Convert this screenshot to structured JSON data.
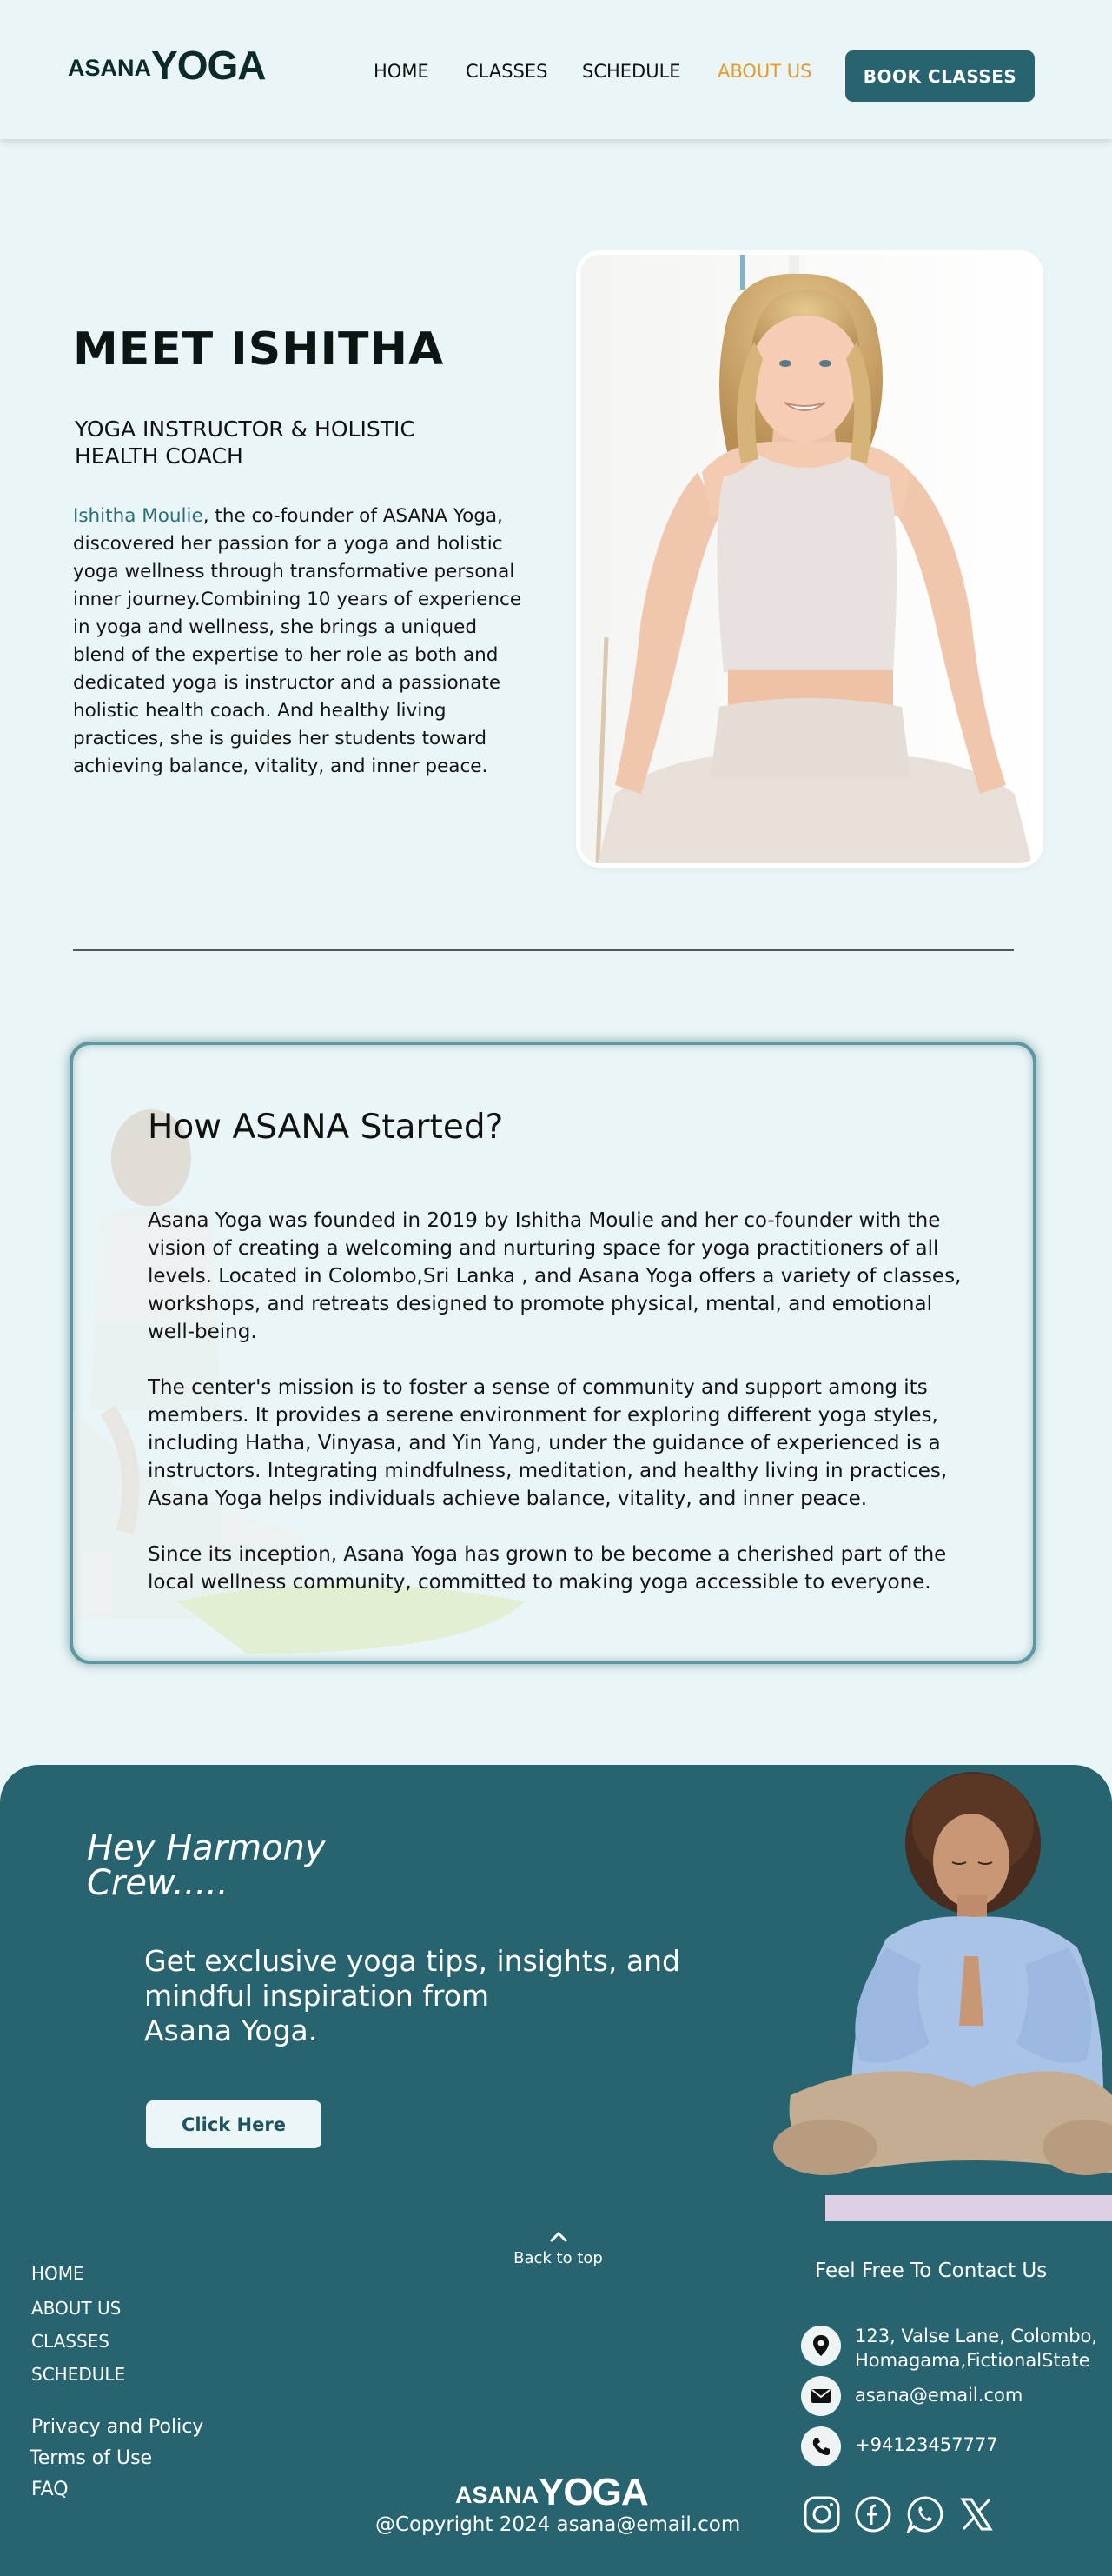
{
  "header": {
    "logo_small": "ASANA",
    "logo_big": "YOGA",
    "nav": [
      "HOME",
      "CLASSES",
      "SCHEDULE",
      "ABOUT US"
    ],
    "active_nav": "ABOUT US",
    "book_label": "BOOK  CLASSES"
  },
  "meet": {
    "title": "MEET  ISHITHA",
    "subtitle": "YOGA INSTRUCTOR & HOLISTIC HEALTH COACH",
    "bio_name": "Ishitha Moulie",
    "bio_text": ", the co-founder of ASANA Yoga, discovered her passion for a yoga and holistic yoga wellness through transformative personal  inner journey.Combining 10 years of experience in yoga and wellness, she brings a uniqued  blend of the expertise to her role as both and dedicated yoga is instructor and a passionate holistic health coach. And healthy living practices, she is guides her students toward achieving balance, vitality, and inner peace."
  },
  "story": {
    "title": "How ASANA Started?",
    "paragraphs": [
      "Asana Yoga was founded in 2019 by Ishitha Moulie and her co-founder with the vision of creating a welcoming and nurturing space for yoga practitioners of all levels. Located in Colombo,Sri Lanka ,  and Asana Yoga offers a variety of classes, workshops, and retreats designed to promote physical, mental, and emotional well-being.",
      "The center's mission is to foster a sense of community and support among its members. It provides a serene environment for exploring different yoga styles, including Hatha, Vinyasa, and Yin Yang, under the guidance of experienced  is a instructors. Integrating mindfulness, meditation, and healthy living in practices, Asana Yoga helps individuals achieve balance, vitality, and inner peace.",
      "Since its inception, Asana Yoga has grown to be become a cherished part of the local wellness community, committed to making yoga accessible to everyone."
    ]
  },
  "newsletter": {
    "greeting_line1": "Hey Harmony",
    "greeting_line2": "Crew.....",
    "tips_line1": "Get exclusive yoga tips, insights, and",
    "tips_line2": "mindful inspiration from",
    "tips_line3": "Asana Yoga.",
    "button_label": "Click  Here"
  },
  "footer": {
    "links": [
      "HOME",
      "ABOUT US",
      "CLASSES",
      "SCHEDULE"
    ],
    "policy_links": [
      "Privacy and Policy",
      "Terms of Use",
      "FAQ"
    ],
    "back_to_top": "Back to top",
    "contact_title": "Feel Free To Contact Us",
    "address_line1": "123, Valse Lane, Colombo,",
    "address_line2": "Homagama,FictionalState",
    "email": "asana@email.com",
    "phone": "+94123457777",
    "logo_small": "ASANA",
    "logo_big": "YOGA",
    "copyright": "@Copyright  2024 asana@email.com",
    "social": [
      "instagram-icon",
      "facebook-icon",
      "whatsapp-icon",
      "x-icon"
    ]
  },
  "colors": {
    "background": "#e9f5f6",
    "primary": "#27646f",
    "accent": "#e59a2b"
  }
}
